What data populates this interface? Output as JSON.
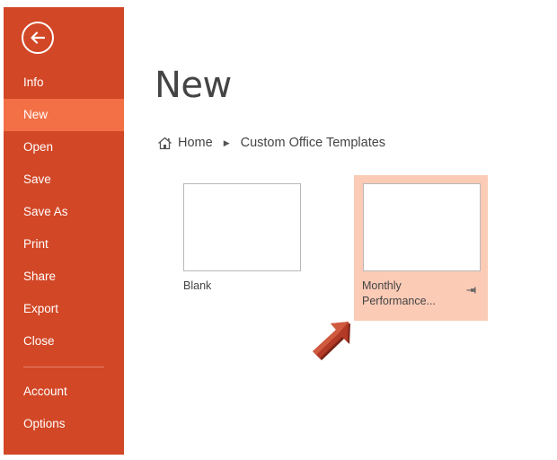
{
  "sidebar": {
    "back_icon": "back-arrow-icon",
    "items": [
      {
        "id": "info",
        "label": "Info"
      },
      {
        "id": "new",
        "label": "New",
        "active": true
      },
      {
        "id": "open",
        "label": "Open"
      },
      {
        "id": "save",
        "label": "Save"
      },
      {
        "id": "save-as",
        "label": "Save As"
      },
      {
        "id": "print",
        "label": "Print"
      },
      {
        "id": "share",
        "label": "Share"
      },
      {
        "id": "export",
        "label": "Export"
      },
      {
        "id": "close",
        "label": "Close"
      }
    ],
    "bottom_items": [
      {
        "id": "account",
        "label": "Account"
      },
      {
        "id": "options",
        "label": "Options"
      }
    ]
  },
  "main": {
    "title": "New",
    "breadcrumb": {
      "home_icon": "home-icon",
      "home_label": "Home",
      "separator_icon": "caret-right-icon",
      "current_label": "Custom Office Templates"
    },
    "templates": [
      {
        "id": "blank",
        "label": "Blank"
      },
      {
        "id": "monthly",
        "label_line1": "Monthly",
        "label_line2": "Performance...",
        "pin_icon": "pin-icon",
        "hovered": true
      }
    ]
  },
  "colors": {
    "sidebar_bg": "#d24726",
    "sidebar_active": "#f36f45",
    "tile_hover": "#fbcbb6",
    "pointer_arrow": "#b33a26"
  },
  "overlay": {
    "pointer_icon": "pointer-arrow-icon"
  }
}
